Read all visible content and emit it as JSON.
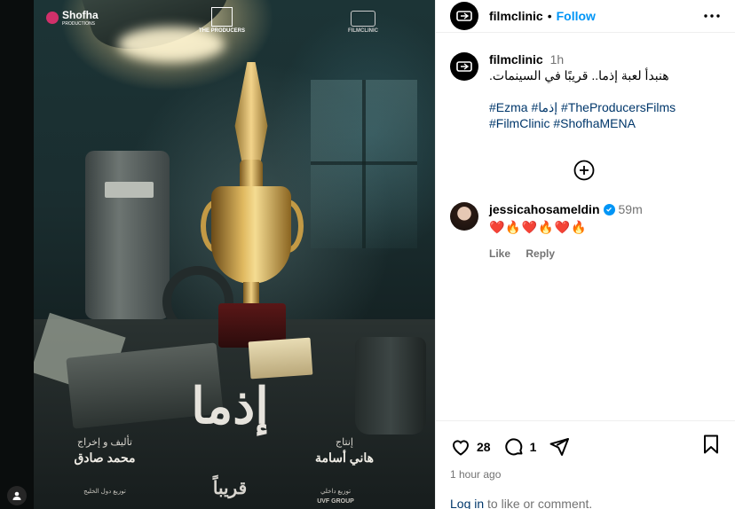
{
  "poster": {
    "logo_shofha": "Shofha",
    "logo_shofha_sub": "PRODUCTIONS",
    "logo_producers": "THE PRODUCERS",
    "logo_filmclinic": "FILMCLINIC",
    "title": "إذما",
    "coming_soon": "قريباً",
    "credit_writer_head": "تأليف و إخراج",
    "credit_writer_name": "محمد صادق",
    "credit_producer_head": "إنتاج",
    "credit_producer_name": "هاني أسامة",
    "dist_gulf": "توزيع دول الخليج",
    "dist_local": "توزيع داخلي",
    "dist_local_company": "UVF GROUP"
  },
  "post": {
    "account": "filmclinic",
    "follow_label": "Follow",
    "more_icon": "more-horizontal-icon",
    "caption_time": "1h",
    "caption_text": "هنبدأ لعبة إذما.. قريبًا في السينمات.",
    "hashtags_line1": "#Ezma #إذما #TheProducersFilms",
    "hashtags_line2": "#FilmClinic #ShofhaMENA"
  },
  "comment": {
    "user": "jessicahosameldin",
    "time": "59m",
    "text": "❤️🔥❤️🔥❤️🔥",
    "like_label": "Like",
    "reply_label": "Reply"
  },
  "actions": {
    "likes": "28",
    "comments": "1",
    "posted_ago": "1 hour ago",
    "login_link": "Log in",
    "login_rest": " to like or comment."
  },
  "colors": {
    "accent": "#0095f6",
    "link": "#00376b",
    "muted": "#737373",
    "heart": "#ed4956"
  }
}
